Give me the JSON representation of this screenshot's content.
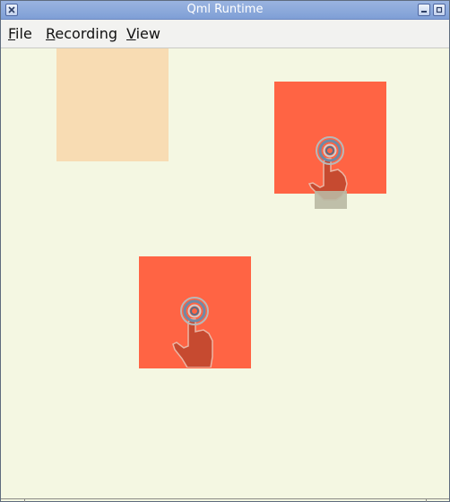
{
  "window": {
    "title": "Qml Runtime"
  },
  "menubar": {
    "items": [
      {
        "label": "File",
        "mnemonic": "F"
      },
      {
        "label": "Recording",
        "mnemonic": "R"
      },
      {
        "label": "View",
        "mnemonic": "V"
      }
    ]
  },
  "colors": {
    "background": "#f4f7e2",
    "square_light": "#f8dcb3",
    "square_active": "#ff6444",
    "hand": "#c64a30",
    "hand_outline": "#e9b3a3",
    "touch_ring": "#6e8aa6"
  },
  "icons": {
    "close": "close-icon",
    "minimize": "minimize-icon",
    "maximize": "maximize-icon",
    "touch_point": "touch-point-hand-icon"
  }
}
